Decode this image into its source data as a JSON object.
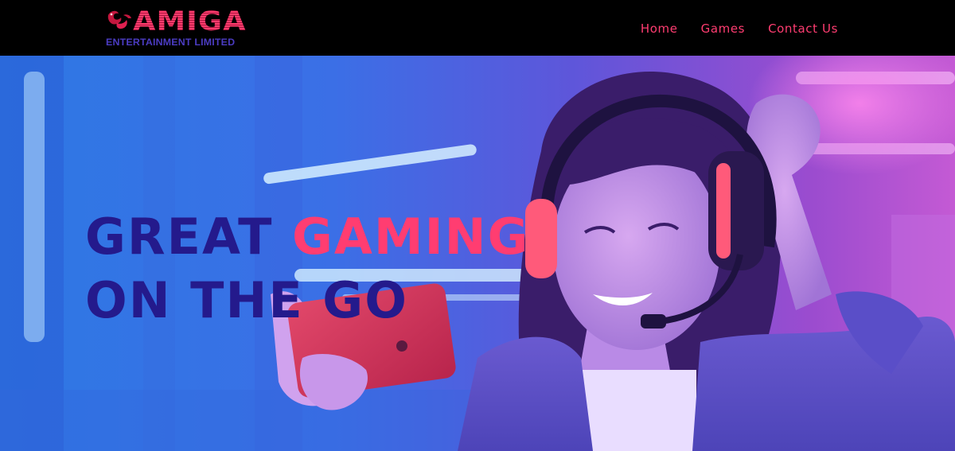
{
  "brand": {
    "logo_word": "AMIGA",
    "logo_subtitle": "ENTERTAINMENT LIMITED"
  },
  "nav": {
    "items": [
      {
        "label": "Home"
      },
      {
        "label": "Games"
      },
      {
        "label": "Contact Us"
      }
    ]
  },
  "hero": {
    "headline_word1": "GREAT",
    "headline_word2": "GAMING",
    "headline_line2": "ON THE GO"
  },
  "colors": {
    "nav_background": "#000000",
    "accent_pink": "#ff3d71",
    "headline_navy": "#241a8c",
    "logo_blue": "#4b3cc2"
  },
  "icons": [
    "dragon-logo-icon"
  ]
}
